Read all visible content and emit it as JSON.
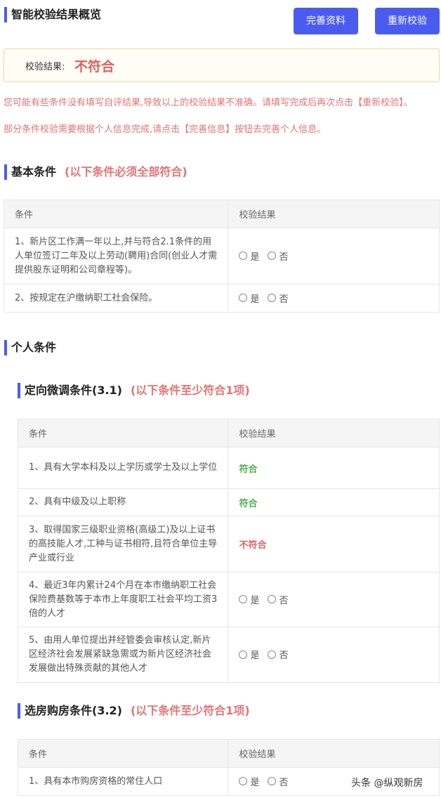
{
  "header": {
    "title": "智能校验结果概览",
    "complete_button": "完善资料",
    "recheck_button": "重新校验"
  },
  "result": {
    "label": "校验结果:",
    "value": "不符合"
  },
  "notices": [
    "您可能有些条件没有填写自评结果,导致以上的校验结果不准确。请填写完成后再次点击【重新校验】。",
    "部分条件校验需要根据个人信息完成,请点击【完善信息】按钮去完善个人信息。"
  ],
  "columns": {
    "condition": "条件",
    "result": "校验结果"
  },
  "radio": {
    "yes": "是",
    "no": "否"
  },
  "basic": {
    "title": "基本条件",
    "hint": "(以下条件必须全部符合)",
    "rows": [
      {
        "text": "1、新片区工作满一年以上,并与符合2.1条件的用人单位签订二年及以上劳动(聘用)合同(创业人才需提供股东证明和公司章程等)。"
      },
      {
        "text": "2、按规定在沪缴纳职工社会保险。"
      }
    ]
  },
  "personal": {
    "title": "个人条件"
  },
  "targeted": {
    "title": "定向微调条件(3.1)",
    "hint": "(以下条件至少符合1项)",
    "rows": [
      {
        "text": "1、具有大学本科及以上学历或学士及以上学位",
        "status": "符合"
      },
      {
        "text": "2、具有中级及以上职称",
        "status": "符合"
      },
      {
        "text": "3、取得国家三级职业资格(高级工)及以上证书的高技能人才,工种与证书相符,且符合单位主导产业或行业",
        "status": "不符合"
      },
      {
        "text": "4、最近3年内累计24个月在本市缴纳职工社会保险费基数等于本市上年度职工社会平均工资3倍的人才"
      },
      {
        "text": "5、由用人单位提出并经管委会审核认定,新片区经济社会发展紧缺急需或为新片区经济社会发展做出特殊贡献的其他人才"
      }
    ]
  },
  "housing": {
    "title": "选房购房条件(3.2)",
    "hint": "(以下条件至少符合1项)",
    "rows": [
      {
        "text": "1、具有本市购房资格的常住人口"
      }
    ]
  },
  "watermark": "头条 @纵观新房"
}
